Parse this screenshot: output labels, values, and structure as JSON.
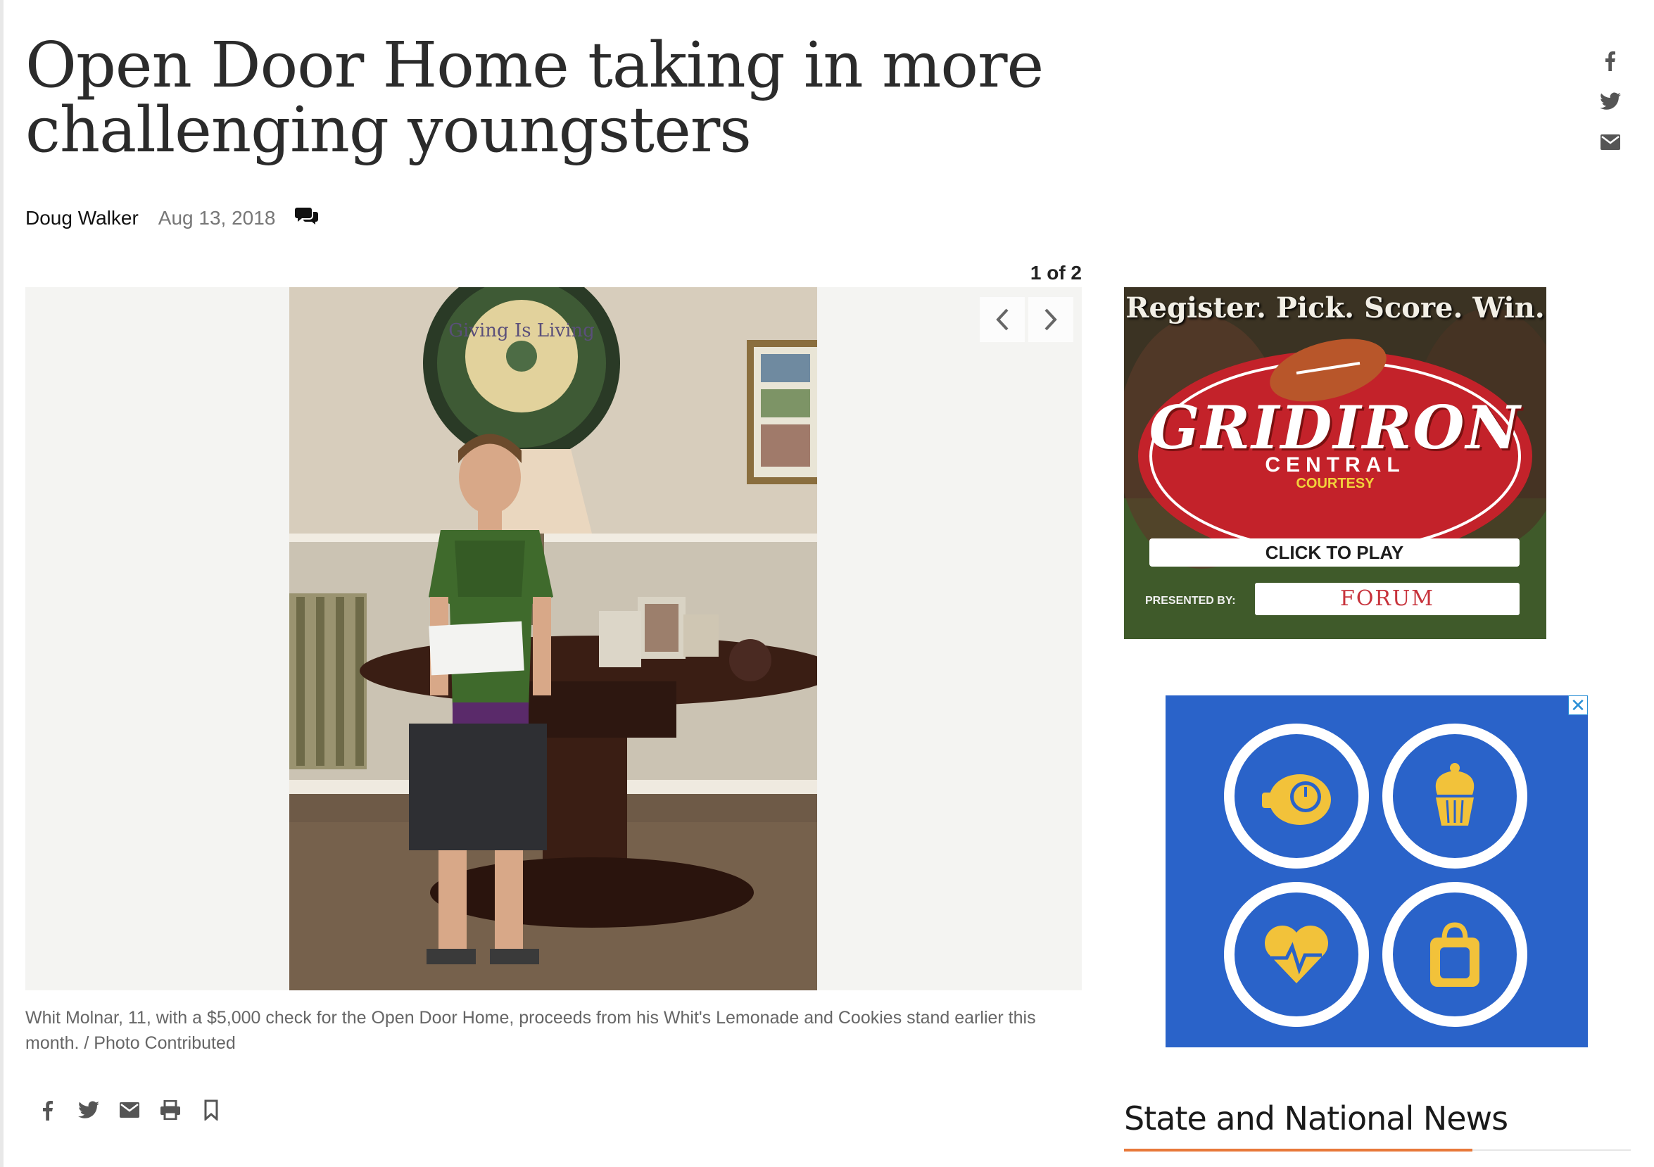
{
  "article": {
    "headline": "Open Door Home taking in more challenging youngsters",
    "author": "Doug Walker",
    "date": "Aug 13, 2018",
    "comments_icon": "comments-icon"
  },
  "share_rail": {
    "icons": [
      "facebook-icon",
      "twitter-icon",
      "email-icon"
    ]
  },
  "gallery": {
    "counter": "1 of 2",
    "prev_icon": "chevron-left-icon",
    "next_icon": "chevron-right-icon",
    "caption": "Whit Molnar, 11, with a $5,000 check for the Open Door Home, proceeds from his Whit's Lemonade and Cookies stand earlier this month. / Photo Contributed",
    "photo_sign_text": "Giving Is Living"
  },
  "article_tools": {
    "icons": [
      "facebook-icon",
      "twitter-icon",
      "email-icon",
      "print-icon",
      "bookmark-icon"
    ]
  },
  "ad_gridiron": {
    "tagline": "Register. Pick. Score. Win.",
    "brand": "GRIDIRON",
    "sub": "CENTRAL",
    "courtesy": "COURTESY",
    "cta": "CLICK TO PLAY",
    "presented_by": "PRESENTED BY:",
    "sponsor": "FORUM"
  },
  "ad_icons": {
    "close_glyph": "✕",
    "icons": [
      "food-timer-icon",
      "cupcake-icon",
      "heart-pulse-icon",
      "grocery-bag-icon"
    ],
    "background_color": "#2a63c9",
    "icon_color": "#f2c23a"
  },
  "sidebar": {
    "section_title": "State and National News",
    "accent_color": "#e8793a"
  }
}
